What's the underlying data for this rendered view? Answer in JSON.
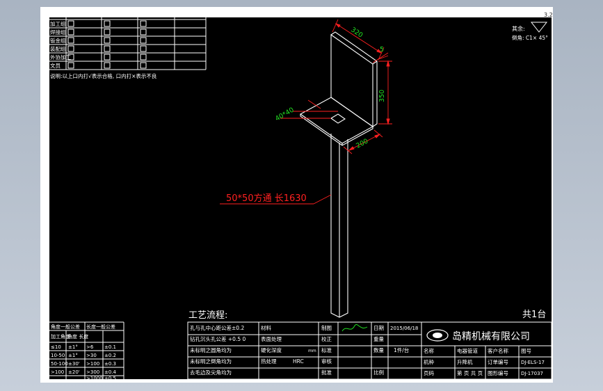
{
  "top_right": {
    "label": "其余:",
    "chamfer": "倒角: C1× 45°",
    "corner": "3.2"
  },
  "inspection": {
    "headers": [
      "",
      "",
      "",
      ""
    ],
    "rows": [
      "加工组",
      "焊接组",
      "钣金组",
      "装配组",
      "外协加工",
      "文员"
    ],
    "note": "说明:以上口内打√表示合格, 口内打×表示不良"
  },
  "dims": {
    "w320": "320",
    "t5": "5",
    "h350": "350",
    "w200": "200",
    "hole": "40*40"
  },
  "callout": "50*50方通 长1630",
  "process": "工艺流程:",
  "total": "共1台",
  "tol": {
    "headers": [
      "角度一般公差",
      "长度一般公差"
    ],
    "rows": [
      [
        "加工角度",
        "角度 长度",
        "",
        ""
      ],
      [
        "≤10",
        "±1°",
        ">6",
        "±0.1"
      ],
      [
        "10-50",
        "±1°",
        ">30",
        "±0.2"
      ],
      [
        "50-100",
        "±30'",
        ">100",
        "±0.3"
      ],
      [
        ">100",
        "±20'",
        ">300",
        "±0.4"
      ],
      [
        "",
        "",
        ">1000",
        "±0.5"
      ]
    ]
  },
  "notes": [
    "孔与孔中心距公差±0.2",
    "钻孔沉头孔公差 +0.5 0",
    "未标明之圆角均为",
    "未标明之倒角均为",
    "去毛边及尖角均为"
  ],
  "tb": {
    "material_label": "材料",
    "material": "",
    "surface_label": "表面处理",
    "heat_label": "热处理",
    "heat_value": "HRC",
    "hardness_label": "硬化深度",
    "unit": "mm",
    "weight_label": "重量",
    "design": "制图",
    "check": "校正",
    "std": "标准",
    "review": "审核",
    "approve": "批准",
    "date_label": "日期",
    "date": "2015/06/18",
    "qty_label": "数量",
    "qty": "1件/台",
    "scale_label": "比例",
    "scale": "",
    "company": "岛精机械有限公司",
    "h1": "名称",
    "h2": "电器管道",
    "h3": "客户名称",
    "h4": "图号",
    "v1": "机种",
    "v2": "升降机",
    "v3": "订单编号",
    "v4": "DJ-ELS-17",
    "w1": "页码",
    "w2": "第 页 共 页",
    "w3": "图形编号",
    "w4": "DJ-17037"
  }
}
